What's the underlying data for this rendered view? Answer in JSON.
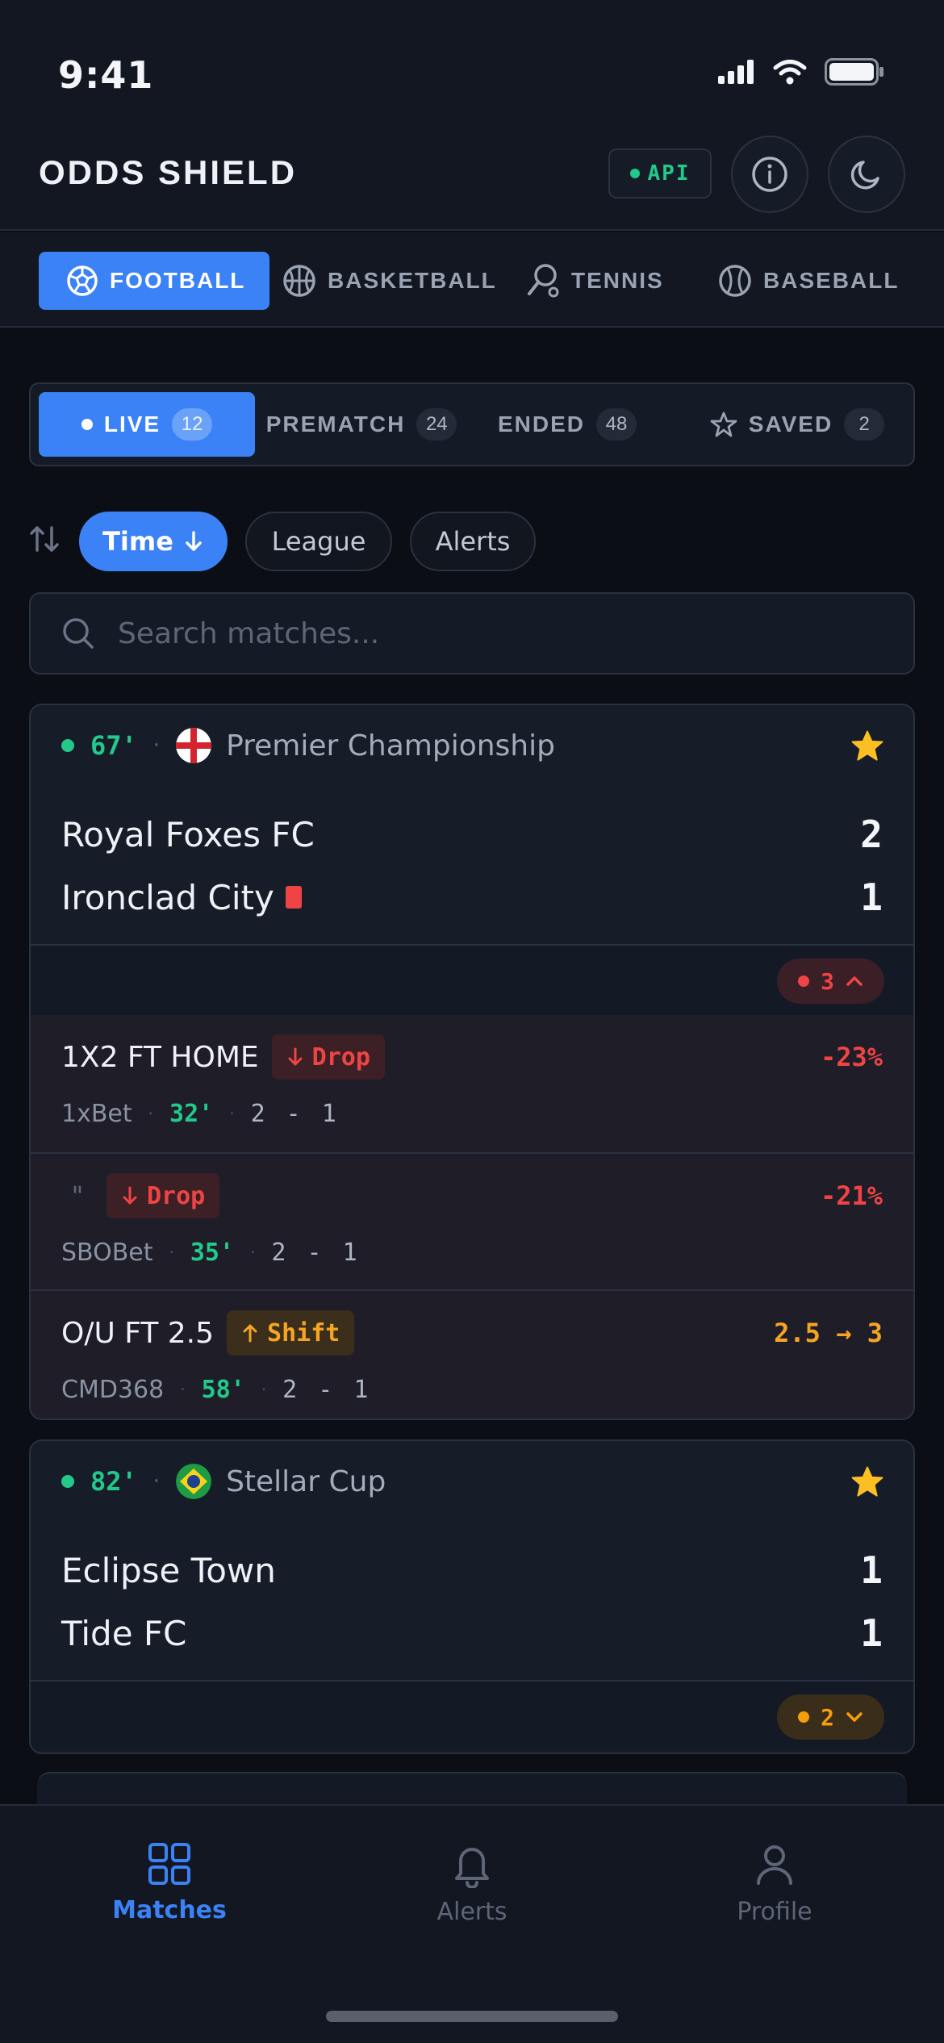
{
  "status_bar": {
    "time": "9:41"
  },
  "header": {
    "brand": "ODDS SHIELD",
    "api_label": "API"
  },
  "sports": [
    {
      "label": "FOOTBALL",
      "active": true
    },
    {
      "label": "BASKETBALL",
      "active": false
    },
    {
      "label": "TENNIS",
      "active": false
    },
    {
      "label": "BASEBALL",
      "active": false
    }
  ],
  "status_tabs": [
    {
      "label": "LIVE",
      "count": "12",
      "active": true
    },
    {
      "label": "PREMATCH",
      "count": "24",
      "active": false
    },
    {
      "label": "ENDED",
      "count": "48",
      "active": false
    },
    {
      "label": "SAVED",
      "count": "2",
      "active": false
    }
  ],
  "filters": {
    "time": "Time",
    "league": "League",
    "alerts": "Alerts"
  },
  "search": {
    "placeholder": "Search matches..."
  },
  "matches": [
    {
      "minute": "67'",
      "league": "Premier Championship",
      "home": {
        "name": "Royal Foxes FC",
        "score": "2"
      },
      "away": {
        "name": "Ironclad City",
        "score": "1",
        "red_card": true
      },
      "alert_count": "3",
      "alerts": [
        {
          "market": "1X2 FT HOME",
          "tag": "Drop",
          "value": "-23%",
          "bookmaker": "1xBet",
          "minute": "32'",
          "score": "2 - 1"
        },
        {
          "market": "\"",
          "tag": "Drop",
          "value": "-21%",
          "bookmaker": "SBOBet",
          "minute": "35'",
          "score": "2 - 1"
        },
        {
          "market": "O/U FT 2.5",
          "tag": "Shift",
          "value": "2.5 → 3",
          "bookmaker": "CMD368",
          "minute": "58'",
          "score": "2 - 1"
        }
      ]
    },
    {
      "minute": "82'",
      "league": "Stellar Cup",
      "home": {
        "name": "Eclipse Town",
        "score": "1"
      },
      "away": {
        "name": "Tide FC",
        "score": "1"
      },
      "alert_count": "2"
    }
  ],
  "bottom_nav": [
    {
      "label": "Matches",
      "active": true
    },
    {
      "label": "Alerts",
      "active": false
    },
    {
      "label": "Profile",
      "active": false
    }
  ],
  "colors": {
    "accent": "#3b82f6",
    "live": "#22c98b",
    "drop": "#ef4444",
    "shift": "#f5a524",
    "star": "#fbbf24"
  }
}
